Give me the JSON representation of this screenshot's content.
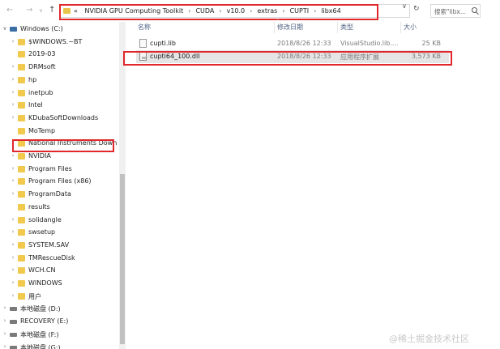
{
  "nav_buttons": {
    "back": "←",
    "forward": "→",
    "dropdown": "∨",
    "up": "↑"
  },
  "address": {
    "root_marker": "«",
    "crumbs": [
      "NVIDIA GPU Computing Toolkit",
      "CUDA",
      "v10.0",
      "extras",
      "CUPTI",
      "libx64"
    ],
    "separator": "›",
    "dropdown": "∨",
    "refresh": "↻"
  },
  "search": {
    "placeholder": "搜索\"libx..."
  },
  "nav_tree": [
    {
      "label": "Windows (C:)",
      "chev": "∨",
      "icon": "drive-c",
      "indent": 1
    },
    {
      "label": "$WINDOWS.~BT",
      "chev": "›",
      "icon": "folder",
      "indent": 2
    },
    {
      "label": "2019-03",
      "chev": "",
      "icon": "folder",
      "indent": 2
    },
    {
      "label": "DRMsoft",
      "chev": "›",
      "icon": "folder",
      "indent": 2
    },
    {
      "label": "hp",
      "chev": "›",
      "icon": "folder",
      "indent": 2
    },
    {
      "label": "inetpub",
      "chev": "›",
      "icon": "folder",
      "indent": 2
    },
    {
      "label": "Intel",
      "chev": "›",
      "icon": "folder",
      "indent": 2
    },
    {
      "label": "KDubaSoftDownloads",
      "chev": "›",
      "icon": "folder",
      "indent": 2
    },
    {
      "label": "MoTemp",
      "chev": "",
      "icon": "folder",
      "indent": 2
    },
    {
      "label": "National Instruments Down",
      "chev": "›",
      "icon": "folder",
      "indent": 2
    },
    {
      "label": "NVIDIA",
      "chev": "›",
      "icon": "folder",
      "indent": 2
    },
    {
      "label": "Program Files",
      "chev": "›",
      "icon": "folder",
      "indent": 2
    },
    {
      "label": "Program Files (x86)",
      "chev": "›",
      "icon": "folder",
      "indent": 2
    },
    {
      "label": "ProgramData",
      "chev": "›",
      "icon": "folder",
      "indent": 2
    },
    {
      "label": "results",
      "chev": "",
      "icon": "folder",
      "indent": 2
    },
    {
      "label": "solidangle",
      "chev": "›",
      "icon": "folder",
      "indent": 2
    },
    {
      "label": "swsetup",
      "chev": "›",
      "icon": "folder",
      "indent": 2
    },
    {
      "label": "SYSTEM.SAV",
      "chev": "›",
      "icon": "folder",
      "indent": 2
    },
    {
      "label": "TMRescueDisk",
      "chev": "›",
      "icon": "folder",
      "indent": 2
    },
    {
      "label": "WCH.CN",
      "chev": "›",
      "icon": "folder",
      "indent": 2
    },
    {
      "label": "WINDOWS",
      "chev": "›",
      "icon": "folder",
      "indent": 2
    },
    {
      "label": "用户",
      "chev": "›",
      "icon": "folder",
      "indent": 2
    },
    {
      "label": "本地磁盘 (D:)",
      "chev": "›",
      "icon": "drive",
      "indent": 1
    },
    {
      "label": "RECOVERY (E:)",
      "chev": "›",
      "icon": "drive",
      "indent": 1
    },
    {
      "label": "本地磁盘 (F:)",
      "chev": "›",
      "icon": "drive",
      "indent": 1
    },
    {
      "label": "本地磁盘 (G:)",
      "chev": "›",
      "icon": "drive",
      "indent": 1
    }
  ],
  "columns": {
    "name": "名称",
    "date": "修改日期",
    "type": "类型",
    "size": "大小",
    "sort_caret": "^"
  },
  "files": [
    {
      "name": "cupti.lib",
      "date": "2018/8/26 12:33",
      "type": "VisualStudio.lib....",
      "size": "25 KB",
      "icon": "file-icon",
      "selected": false
    },
    {
      "name": "cupti64_100.dll",
      "date": "2018/8/26 12:33",
      "type": "应用程序扩展",
      "size": "3,573 KB",
      "icon": "dll-icon",
      "selected": true
    }
  ],
  "highlight_color": "#e0282c",
  "watermark": "@稀土掘金技术社区"
}
